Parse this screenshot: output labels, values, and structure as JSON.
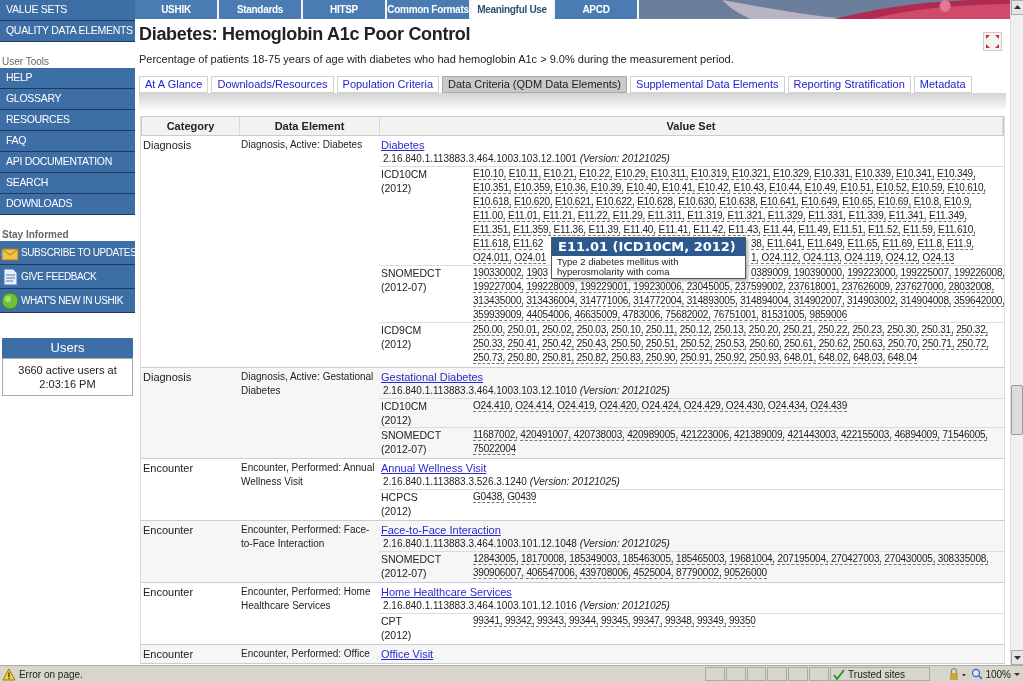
{
  "sidebar": {
    "top_items": [
      "VALUE SETS",
      "QUALITY DATA ELEMENTS"
    ],
    "user_tools": {
      "heading": "User Tools",
      "items": [
        "HELP",
        "GLOSSARY",
        "RESOURCES",
        "FAQ",
        "API DOCUMENTATION",
        "SEARCH",
        "DOWNLOADS"
      ]
    },
    "stay_informed": {
      "heading": "Stay Informed",
      "items": [
        {
          "label": "SUBSCRIBE TO UPDATES",
          "kind": "envelope"
        },
        {
          "label": "GIVE FEEDBACK",
          "kind": "document"
        },
        {
          "label": "WHAT'S NEW IN USHIK",
          "kind": "bubble"
        }
      ]
    },
    "users_panel": {
      "title": "Users",
      "text": "3660 active users at 2:03:16 PM"
    }
  },
  "top_nav": {
    "tabs": [
      {
        "label": "USHIK",
        "selected": false
      },
      {
        "label": "Standards",
        "selected": false
      },
      {
        "label": "HITSP",
        "selected": false
      },
      {
        "label": "Common Formats",
        "selected": false
      },
      {
        "label": "Meaningful Use",
        "selected": true
      },
      {
        "label": "APCD",
        "selected": false
      }
    ]
  },
  "page": {
    "title": "Diabetes: Hemoglobin A1c Poor Control",
    "description": "Percentage of patients 18-75 years of age with diabetes who had hemoglobin A1c > 9.0% during the measurement period.",
    "tabs": [
      {
        "label": "At A Glance",
        "selected": false
      },
      {
        "label": "Downloads/Resources",
        "selected": false
      },
      {
        "label": "Population Criteria",
        "selected": false
      },
      {
        "label": "Data Criteria (QDM Data Elements)",
        "selected": true
      },
      {
        "label": "Supplemental Data Elements",
        "selected": false
      },
      {
        "label": "Reporting Stratification",
        "selected": false
      },
      {
        "label": "Metadata",
        "selected": false
      }
    ]
  },
  "table": {
    "columns": [
      "Category",
      "Data Element",
      "Value Set"
    ],
    "rows": [
      {
        "category": "Diagnosis",
        "data_element": "Diagnosis, Active: Diabetes",
        "value_set": {
          "name": "Diabetes",
          "oid": "2.16.840.1.113883.3.464.1003.103.12.1001 *(Version: 20121025)*",
          "code_systems": [
            {
              "system": "ICD10CM",
              "year": "(2012)",
              "lines": [
                [
                  "E10.10, E10.11, E10.21, E10.22, E10.29, E10.311, E10.319, E10.321, E10.329, E10.331, E10.339, E10.341, E10.349,"
                ],
                [
                  "E10.351, E10.359, E10.36, E10.39, E10.40, E10.41, E10.42, E10.43, E10.44, E10.49, E10.51, E10.52, E10.59, E10.610,"
                ],
                [
                  "E10.618, E10.620, E10.621, E10.622, E10.628, E10.630, E10.638, E10.641, E10.649, E10.65, E10.69, E10.8, E10.9,"
                ],
                [
                  "E11.00, E11.01, E11.21, E11.22, E11.29, E11.311, E11.319, E11.321, E11.329, E11.331, E11.339, E11.341, E11.349,"
                ],
                [
                  "E11.351, E11.359, E11.36, E11.39, E11.40, E11.41, E11.42, E11.43, E11.44, E11.49, E11.51, E11.52, E11.59, E11.610,"
                ],
                [
                  "E11.618, E11.62",
                  "38, E11.641, E11.649, E11.65, E11.69, E11.8, E11.9,"
                ],
                [
                  "O24.011, O24.01",
                  "1, O24.112, O24.113, O24.119, O24.12, O24.13"
                ]
              ]
            },
            {
              "system": "SNOMEDCT",
              "year": "(2012-07)",
              "lines": [
                [
                  "190330002, 1903",
                  "0389009, 190390000, 199223000, 199225007, 199226008,"
                ],
                [
                  "199227004, 199228009, 199229001, 199230006, 23045005, 237599002, 237618001, 237626009, 237627000, 28032008,"
                ],
                [
                  "313435000, 313436004, 314771006, 314772004, 314893005, 314894004, 314902007, 314903002, 314904008, 359642000,"
                ],
                [
                  "359939009, 44054006, 46635009, 4783006, 75682002, 76751001, 81531005, 9859006"
                ]
              ]
            },
            {
              "system": "ICD9CM",
              "year": "(2012)",
              "lines": [
                [
                  "250.00, 250.01, 250.02, 250.03, 250.10, 250.11, 250.12, 250.13, 250.20, 250.21, 250.22, 250.23, 250.30, 250.31, 250.32,"
                ],
                [
                  "250.33, 250.41, 250.42, 250.43, 250.50, 250.51, 250.52, 250.53, 250.60, 250.61, 250.62, 250.63, 250.70, 250.71, 250.72,"
                ],
                [
                  "250.73, 250.80, 250.81, 250.82, 250.83, 250.90, 250.91, 250.92, 250.93, 648.01, 648.02, 648.03, 648.04"
                ]
              ]
            }
          ]
        }
      },
      {
        "category": "Diagnosis",
        "data_element": "Diagnosis, Active: Gestational Diabetes",
        "value_set": {
          "name": "Gestational Diabetes",
          "oid": "2.16.840.1.113883.3.464.1003.103.12.1010 *(Version: 20121025)*",
          "code_systems": [
            {
              "system": "ICD10CM",
              "year": "(2012)",
              "lines": [
                [
                  "O24.410, O24.414, O24.419, O24.420, O24.424, O24.429, O24.430, O24.434, O24.439"
                ]
              ]
            },
            {
              "system": "SNOMEDCT",
              "year": "(2012-07)",
              "lines": [
                [
                  "11687002, 420491007, 420738003, 420989005, 421223006, 421389009, 421443003, 422155003, 46894009, 71546005,"
                ],
                [
                  "75022004"
                ]
              ]
            }
          ]
        }
      },
      {
        "category": "Encounter",
        "data_element": "Encounter, Performed: Annual Wellness Visit",
        "value_set": {
          "name": "Annual Wellness Visit",
          "oid": "2.16.840.1.113883.3.526.3.1240 *(Version: 20121025)*",
          "code_systems": [
            {
              "system": "HCPCS",
              "year": "(2012)",
              "lines": [
                [
                  "G0438, G0439"
                ]
              ]
            }
          ]
        }
      },
      {
        "category": "Encounter",
        "data_element": "Encounter, Performed: Face-to-Face Interaction",
        "value_set": {
          "name": "Face-to-Face Interaction",
          "oid": "2.16.840.1.113883.3.464.1003.101.12.1048 *(Version: 20121025)*",
          "code_systems": [
            {
              "system": "SNOMEDCT",
              "year": "(2012-07)",
              "lines": [
                [
                  "12843005, 18170008, 185349003, 185463005, 185465003, 19681004, 207195004, 270427003, 270430005, 308335008,"
                ],
                [
                  "390906007, 406547006, 439708006, 4525004, 87790002, 90526000"
                ]
              ]
            }
          ]
        }
      },
      {
        "category": "Encounter",
        "data_element": "Encounter, Performed: Home Healthcare Services",
        "value_set": {
          "name": "Home Healthcare Services",
          "oid": "2.16.840.1.113883.3.464.1003.101.12.1016 *(Version: 20121025)*",
          "code_systems": [
            {
              "system": "CPT",
              "year": "(2012)",
              "lines": [
                [
                  "99341, 99342, 99343, 99344, 99345, 99347, 99348, 99349, 99350"
                ]
              ]
            }
          ]
        }
      },
      {
        "category": "Encounter",
        "data_element": "Encounter, Performed: Office",
        "value_set": {
          "name": "Office Visit"
        }
      }
    ]
  },
  "tooltip": {
    "title": "E11.01 (ICD10CM, 2012)",
    "text": "Type 2 diabetes mellitus with hyperosmolarity with coma"
  },
  "status_bar": {
    "message": "Error on page.",
    "zone": "Trusted sites",
    "zoom": "100%"
  }
}
